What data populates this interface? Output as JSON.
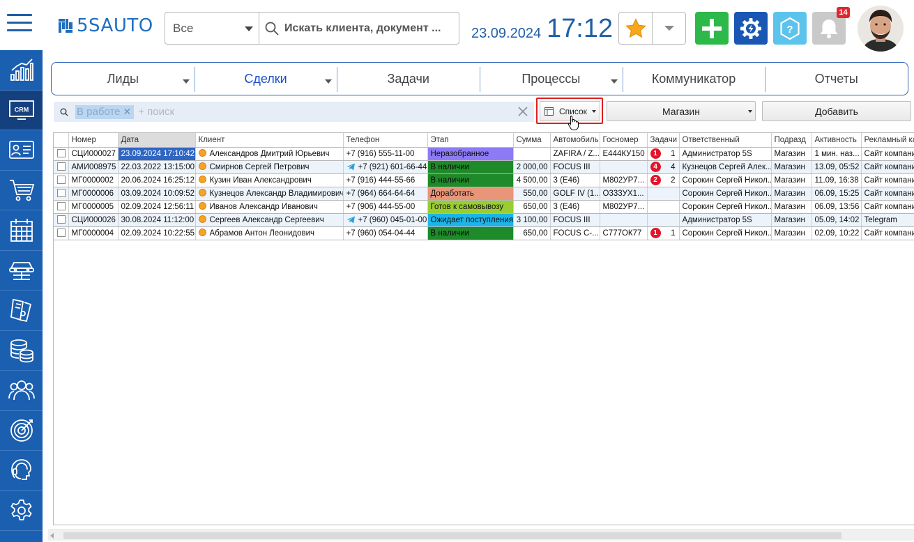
{
  "header": {
    "logo_text": "5SAUTO",
    "filter_value": "Все",
    "search_placeholder": "Искать клиента, документ ...",
    "date": "23.09.2024",
    "time": "17:12",
    "notifications_count": "14"
  },
  "sidebar": {
    "items": [
      {
        "name": "analytics",
        "icon": "chart-icon"
      },
      {
        "name": "crm",
        "icon": "crm-icon",
        "label": "CRM",
        "active": true
      },
      {
        "name": "contacts",
        "icon": "contact-card-icon"
      },
      {
        "name": "sales",
        "icon": "cart-icon"
      },
      {
        "name": "calendar",
        "icon": "calendar-icon"
      },
      {
        "name": "service",
        "icon": "car-lift-icon"
      },
      {
        "name": "parts",
        "icon": "catalog-icon"
      },
      {
        "name": "finance",
        "icon": "coins-icon"
      },
      {
        "name": "staff",
        "icon": "team-icon"
      },
      {
        "name": "marketing",
        "icon": "target-icon"
      },
      {
        "name": "telephony",
        "icon": "headset-icon"
      },
      {
        "name": "settings",
        "icon": "gear-icon"
      }
    ]
  },
  "tabs": [
    {
      "label": "Лиды",
      "dropdown": true
    },
    {
      "label": "Сделки",
      "dropdown": true,
      "active": true
    },
    {
      "label": "Задачи",
      "dropdown": false
    },
    {
      "label": "Процессы",
      "dropdown": true
    },
    {
      "label": "Коммуникатор",
      "dropdown": false
    },
    {
      "label": "Отчеты",
      "dropdown": false
    }
  ],
  "toolbar": {
    "filter_chip": "В работе",
    "search_placeholder": "+ поиск",
    "view_label": "Список",
    "store_label": "Магазин",
    "add_label": "Добавить"
  },
  "table": {
    "columns": [
      "Номер",
      "Дата",
      "Клиент",
      "Телефон",
      "Этап",
      "Сумма",
      "Автомобиль",
      "Госномер",
      "Задачи",
      "Ответственный",
      "Подразд",
      "Активность",
      "Рекламный канал"
    ],
    "rows": [
      {
        "number": "СЦИ000027",
        "date": "23.09.2024 17:10:42",
        "client": "Александров Дмитрий Юрьевич",
        "phone": "+7 (916) 555-11-00",
        "telegram": false,
        "stage": "Неразобранное",
        "stage_color": "#8c7bf5",
        "stage_text_color": "#111111",
        "sum": "",
        "car": "ZAFIRA / Z...",
        "plate": "Е444КУ150",
        "tasks_badge": "1",
        "tasks_count": "1",
        "responsible": "Администратор 5S",
        "dept": "Магазин",
        "activity": "1 мин. наз...",
        "channel": "Сайт компании"
      },
      {
        "number": "АМИ008975",
        "date": "22.03.2022 13:15:00",
        "client": "Смирнов Сергей Петрович",
        "phone": "+7 (921) 601-66-44",
        "telegram": true,
        "stage": "В наличии",
        "stage_color": "#1f8a2a",
        "stage_text_color": "#0a0a0a",
        "sum": "2 000,00",
        "car": "FOCUS III",
        "plate": "",
        "tasks_badge": "4",
        "tasks_count": "4",
        "responsible": "Кузнецов Сергей Алек...",
        "dept": "Магазин",
        "activity": "13.09, 05:52",
        "channel": "Сайт компании"
      },
      {
        "number": "МГ0000002",
        "date": "20.06.2024 16:25:12",
        "client": "Кузин Иван Александрович",
        "phone": "+7 (916) 444-55-66",
        "telegram": false,
        "stage": "В наличии",
        "stage_color": "#1f8a2a",
        "stage_text_color": "#0a0a0a",
        "sum": "4 500,00",
        "car": "3 (E46)",
        "plate": "М802УР7...",
        "tasks_badge": "2",
        "tasks_count": "2",
        "responsible": "Сорокин Сергей Никол...",
        "dept": "Магазин",
        "activity": "11.09, 16:38",
        "channel": "Сайт компании"
      },
      {
        "number": "МГ0000006",
        "date": "03.09.2024 10:09:52",
        "client": "Кузнецов Александр Владимирович",
        "phone": "+7 (964) 664-64-64",
        "telegram": false,
        "stage": "Доработать",
        "stage_color": "#e8957a",
        "stage_text_color": "#111111",
        "sum": "550,00",
        "car": "GOLF IV (1...",
        "plate": "О333УХ1...",
        "tasks_badge": "",
        "tasks_count": "",
        "responsible": "Сорокин Сергей Никол...",
        "dept": "Магазин",
        "activity": "06.09, 15:25",
        "channel": "Сайт компании"
      },
      {
        "number": "МГ0000005",
        "date": "02.09.2024 12:56:11",
        "client": "Иванов Александр Иванович",
        "phone": "+7 (906) 444-55-00",
        "telegram": false,
        "stage": "Готов к самовывозу",
        "stage_color": "#9acd32",
        "stage_text_color": "#111111",
        "sum": "650,00",
        "car": "3 (E46)",
        "plate": "М802УР7...",
        "tasks_badge": "",
        "tasks_count": "",
        "responsible": "Сорокин Сергей Никол...",
        "dept": "Магазин",
        "activity": "06.09, 13:56",
        "channel": "Сайт компании"
      },
      {
        "number": "СЦИ000026",
        "date": "30.08.2024 11:12:00",
        "client": "Сергеев Александр Сергеевич",
        "phone": "+7 (960) 045-01-00",
        "telegram": true,
        "stage": "Ожидает поступления",
        "stage_color": "#1bb5e8",
        "stage_text_color": "#111111",
        "sum": "3 100,00",
        "car": "FOCUS III",
        "plate": "",
        "tasks_badge": "",
        "tasks_count": "",
        "responsible": "Администратор 5S",
        "dept": "Магазин",
        "activity": "05.09, 14:02",
        "channel": "Telegram"
      },
      {
        "number": "МГ0000004",
        "date": "02.09.2024 10:22:55",
        "client": "Абрамов Антон Леонидович",
        "phone": "+7 (960) 054-04-44",
        "telegram": false,
        "stage": "В наличии",
        "stage_color": "#1f8a2a",
        "stage_text_color": "#0a0a0a",
        "sum": "650,00",
        "car": "FOCUS C-...",
        "plate": "С777ОК77",
        "tasks_badge": "1",
        "tasks_count": "1",
        "responsible": "Сорокин Сергей Никол...",
        "dept": "Магазин",
        "activity": "02.09, 10:22",
        "channel": "Сайт компании"
      }
    ]
  },
  "colors": {
    "brand": "#1f5fa8",
    "sidebar": "#1b5fb0",
    "active_tab": "#1a50c8",
    "selection": "#2f66c4"
  }
}
